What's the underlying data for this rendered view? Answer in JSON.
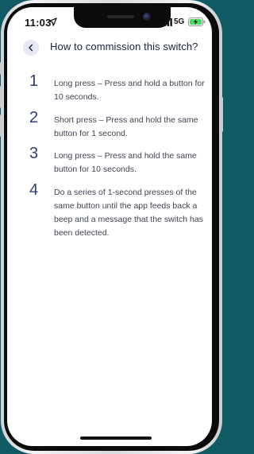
{
  "status_bar": {
    "time": "11:03",
    "network": "5G",
    "icons": [
      "location-arrow-icon",
      "signal-bars-icon",
      "battery-charging-icon"
    ],
    "battery_color": "#4cd964"
  },
  "header": {
    "back_icon": "chevron-left-icon",
    "title": "How to commission this switch?"
  },
  "steps": [
    {
      "number": "1",
      "text": "Long press – Press and hold a button for 10 seconds."
    },
    {
      "number": "2",
      "text": "Short press – Press and hold the same button for 1 second."
    },
    {
      "number": "3",
      "text": "Long press – Press and hold the same button for 10 seconds."
    },
    {
      "number": "4",
      "text": "Do a series of 1-second presses of the same button until the app feeds back a beep and a message that the switch has been detected."
    }
  ],
  "colors": {
    "background": "#0f5a63",
    "accent": "#2d3e79",
    "title": "#1c2340",
    "body_text": "#3f4452",
    "back_button_bg": "#e8e9f4"
  }
}
